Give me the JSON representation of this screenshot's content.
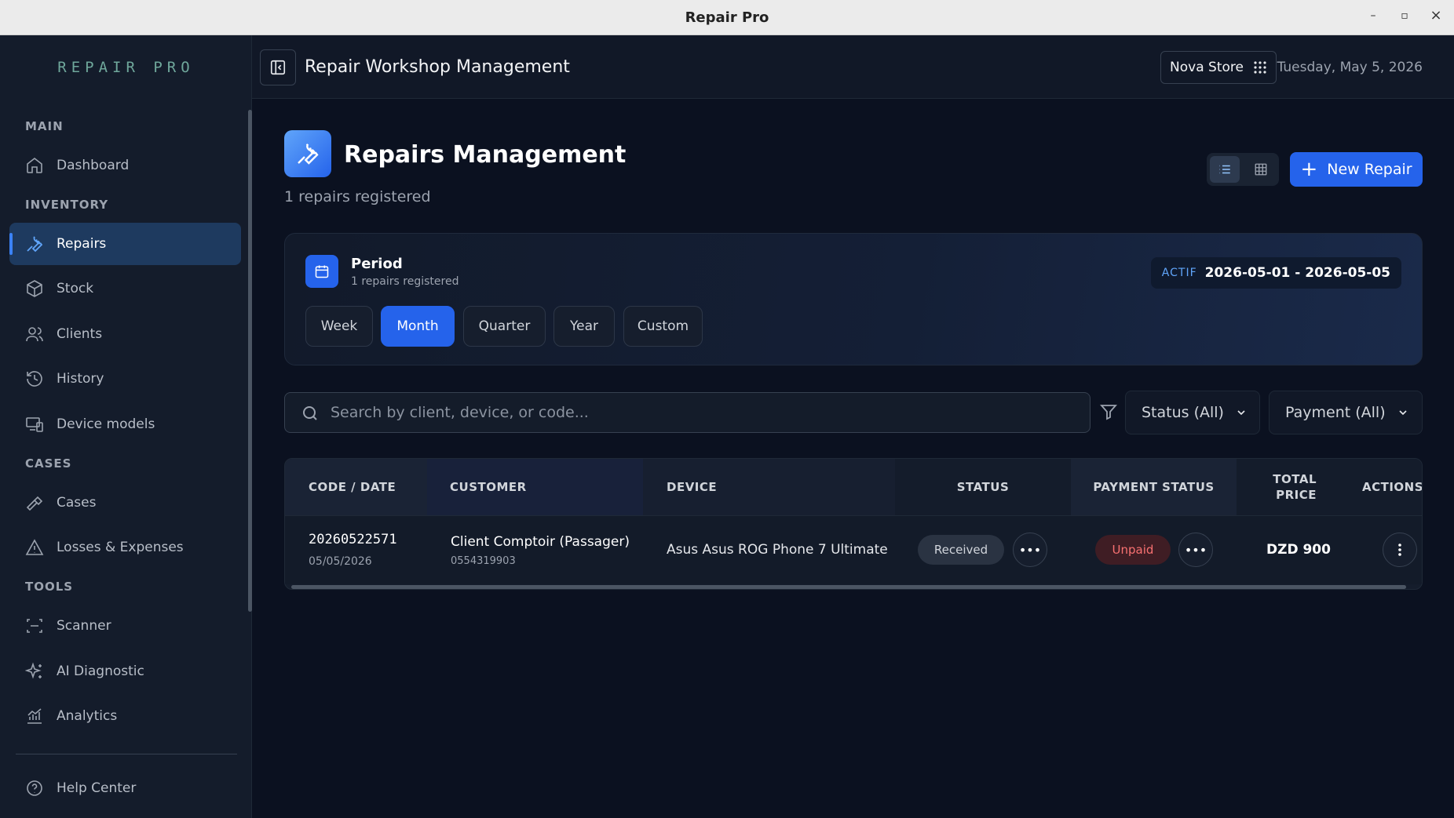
{
  "window": {
    "title": "Repair Pro",
    "min": "–",
    "max": "▫",
    "close": "×"
  },
  "sidebar": {
    "logo": "REPAIR PRO",
    "sections": {
      "main": "MAIN",
      "inventory": "INVENTORY",
      "cases": "CASES",
      "tools": "TOOLS"
    },
    "items": {
      "dashboard": "Dashboard",
      "repairs": "Repairs",
      "stock": "Stock",
      "clients": "Clients",
      "history": "History",
      "device_models": "Device models",
      "cases": "Cases",
      "losses": "Losses & Expenses",
      "scanner": "Scanner",
      "ai_diagnostic": "AI Diagnostic",
      "analytics": "Analytics",
      "help": "Help Center"
    },
    "active": "repairs"
  },
  "header": {
    "title": "Repair Workshop Management",
    "store": "Nova Store",
    "date": "Tuesday, May 5, 2026"
  },
  "page": {
    "title": "Repairs Management",
    "subtitle": "1 repairs registered",
    "new_button": "New Repair"
  },
  "period": {
    "title": "Period",
    "subtitle": "1 repairs registered",
    "options": [
      "Week",
      "Month",
      "Quarter",
      "Year",
      "Custom"
    ],
    "selected": "Month",
    "status_label": "ACTIF",
    "range": "2026-05-01 - 2026-05-05"
  },
  "search": {
    "placeholder": "Search by client, device, or code...",
    "value": ""
  },
  "filters": {
    "status": "Status (All)",
    "payment": "Payment (All)"
  },
  "table": {
    "columns": {
      "code_date": "CODE / DATE",
      "customer": "CUSTOMER",
      "device": "DEVICE",
      "status": "STATUS",
      "payment_status": "PAYMENT STATUS",
      "total_price_1": "TOTAL",
      "total_price_2": "PRICE",
      "actions": "ACTIONS"
    },
    "rows": [
      {
        "code": "20260522571",
        "date": "05/05/2026",
        "customer": "Client Comptoir (Passager)",
        "phone": "0554319903",
        "device": "Asus Asus ROG Phone 7 Ultimate",
        "status": "Received",
        "payment": "Unpaid",
        "total": "DZD 900"
      }
    ]
  },
  "colors": {
    "accent": "#2563eb",
    "unpaid_bg": "#3f1d24",
    "unpaid_text": "#f87171",
    "received_bg": "#2a3342"
  }
}
